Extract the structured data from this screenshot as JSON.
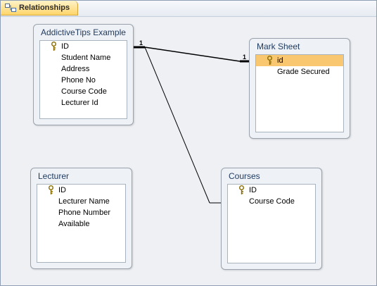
{
  "tab": {
    "label": "Relationships",
    "icon": "relationships-icon"
  },
  "tables": [
    {
      "title": "AddictiveTips Example",
      "fields": [
        {
          "name": "ID",
          "key": true
        },
        {
          "name": "Student Name",
          "key": false
        },
        {
          "name": "Address",
          "key": false
        },
        {
          "name": "Phone No",
          "key": false
        },
        {
          "name": "Course Code",
          "key": false
        },
        {
          "name": "Lecturer Id",
          "key": false
        }
      ]
    },
    {
      "title": "Mark Sheet",
      "fields": [
        {
          "name": "id",
          "key": true,
          "selected": true
        },
        {
          "name": "Grade Secured",
          "key": false
        }
      ]
    },
    {
      "title": "Lecturer",
      "fields": [
        {
          "name": "ID",
          "key": true
        },
        {
          "name": "Lecturer Name",
          "key": false
        },
        {
          "name": "Phone Number",
          "key": false
        },
        {
          "name": "Available",
          "key": false
        }
      ]
    },
    {
      "title": "Courses",
      "fields": [
        {
          "name": "ID",
          "key": true
        },
        {
          "name": "Course Code",
          "key": false
        }
      ]
    }
  ],
  "relationships": [
    {
      "from": "AddictiveTips Example.ID",
      "to": "Mark Sheet.id",
      "from_cardinality": "1",
      "to_cardinality": "1"
    },
    {
      "from": "AddictiveTips Example.ID",
      "to": "Courses.ID",
      "from_cardinality": "",
      "to_cardinality": ""
    }
  ],
  "colors": {
    "selected_field": "#fac771",
    "tab": "#ffd56a",
    "title_text": "#1e3a5f"
  }
}
